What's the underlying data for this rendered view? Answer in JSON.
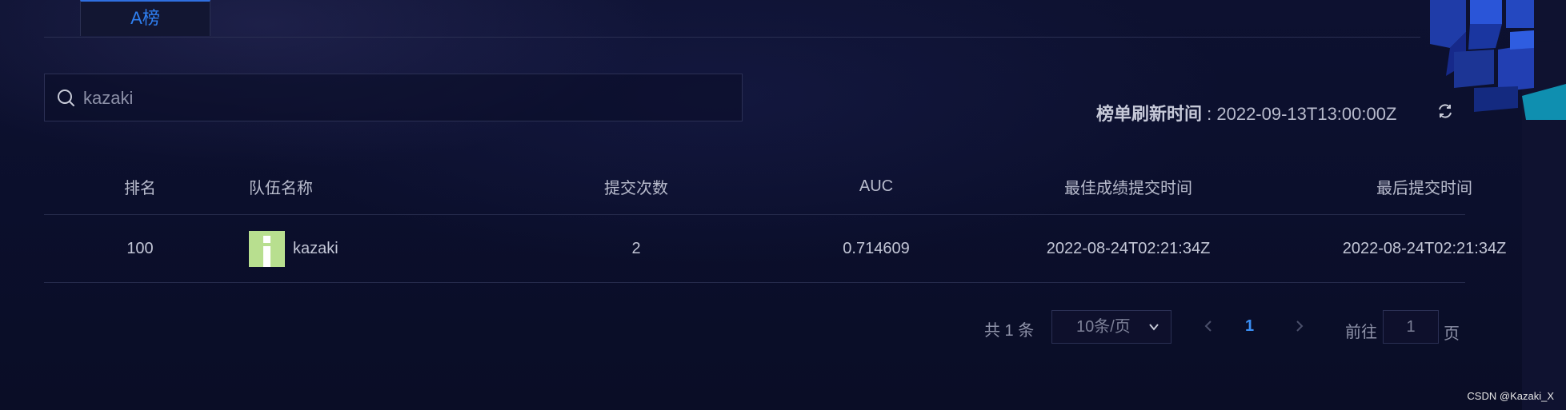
{
  "tabs": [
    {
      "label": "A榜",
      "active": true
    }
  ],
  "search": {
    "value": "kazaki",
    "placeholder": ""
  },
  "refresh": {
    "label": "榜单刷新时间",
    "separator": " : ",
    "time": "2022-09-13T13:00:00Z"
  },
  "table": {
    "headers": {
      "rank": "排名",
      "team": "队伍名称",
      "count": "提交次数",
      "auc": "AUC",
      "best": "最佳成绩提交时间",
      "last": "最后提交时间"
    },
    "rows": [
      {
        "rank": "100",
        "team": "kazaki",
        "count": "2",
        "auc": "0.714609",
        "best": "2022-08-24T02:21:34Z",
        "last": "2022-08-24T02:21:34Z"
      }
    ]
  },
  "pagination": {
    "total": "共 1 条",
    "page_size": "10条/页",
    "current_page": "1",
    "goto_label": "前往",
    "goto_value": "1",
    "goto_suffix": "页"
  },
  "watermark": "CSDN @Kazaki_X",
  "colors": {
    "accent": "#2f7ff0",
    "background": "#0b0f2a",
    "avatar": "#b8df8f"
  },
  "icons": [
    "search-icon",
    "refresh-icon",
    "chevron-down-icon",
    "chevron-left-icon",
    "chevron-right-icon"
  ]
}
